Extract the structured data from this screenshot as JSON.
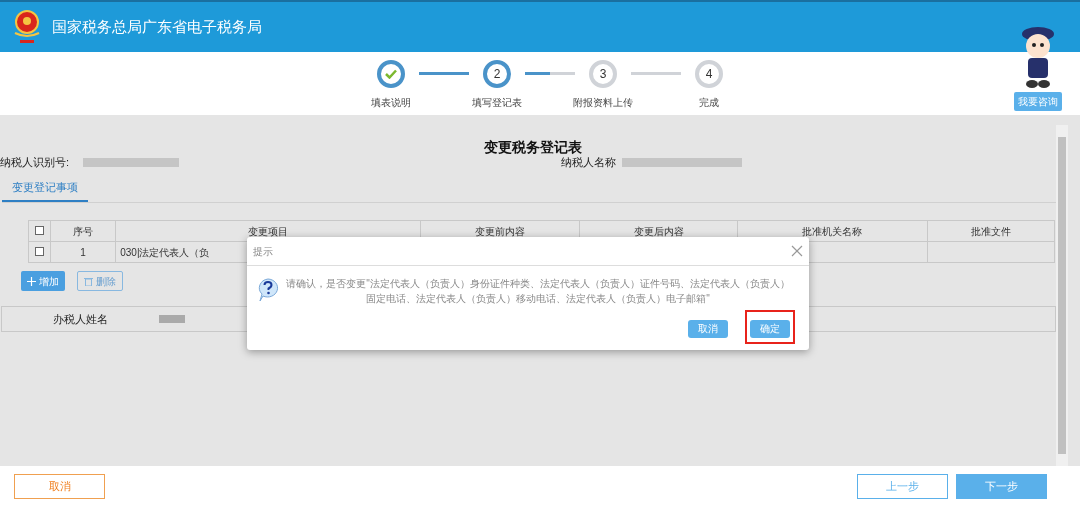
{
  "header": {
    "title": "国家税务总局广东省电子税务局"
  },
  "steps": [
    {
      "kind": "done",
      "label": "填表说明"
    },
    {
      "kind": "current",
      "number": "2",
      "label": "填写登记表"
    },
    {
      "kind": "todo",
      "number": "3",
      "label": "附报资料上传"
    },
    {
      "kind": "todo",
      "number": "4",
      "label": "完成"
    }
  ],
  "consult_button": "我要咨询",
  "form": {
    "title": "变更税务登记表",
    "taxpayer_id_label": "纳税人识别号:",
    "taxpayer_name_label": "纳税人名称"
  },
  "tabs": [
    {
      "label": "变更登记事项",
      "selected": true
    }
  ],
  "table": {
    "all_checked": false,
    "columns": [
      "序号",
      "变更项目",
      "变更前内容",
      "变更后内容",
      "批准机关名称",
      "批准文件"
    ],
    "rows": [
      {
        "checked": false,
        "cells": [
          "1",
          "030|法定代表人（负",
          "",
          "",
          "",
          ""
        ]
      }
    ]
  },
  "actions": [
    {
      "kind": "add",
      "label": "增加"
    },
    {
      "kind": "delete",
      "label": "删除"
    }
  ],
  "handler": {
    "label": "办税人姓名"
  },
  "dialog": {
    "title": "提示",
    "message": "请确认，是否变更\"法定代表人（负责人）身份证件种类、法定代表人（负责人）证件号码、法定代表人（负责人）固定电话、法定代表人（负责人）移动电话、法定代表人（负责人）电子邮箱\"",
    "buttons": [
      {
        "label": "取消",
        "highlighted": false
      },
      {
        "label": "确定",
        "highlighted": true
      }
    ]
  },
  "footer": [
    {
      "kind": "cancel",
      "label": "取消"
    },
    {
      "kind": "prev",
      "label": "上一步"
    },
    {
      "kind": "next",
      "label": "下一步"
    }
  ]
}
